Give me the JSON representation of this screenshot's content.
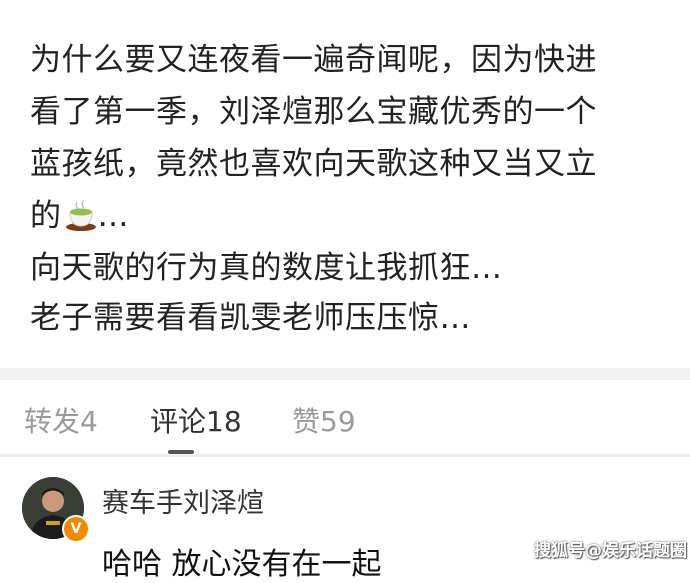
{
  "post": {
    "lines": [
      "为什么要又连夜看一遍奇闻呢，因为快进",
      "看了第一季，刘泽煊那么宝藏优秀的一个",
      "蓝孩纸，竟然也喜欢向天歌这种又当又立",
      "向天歌的行为真的数度让我抓狂…",
      "老子需要看看凯雯老师压压惊…"
    ],
    "line4_prefix": "的",
    "line4_emoji": "tea-icon",
    "line4_suffix": "…"
  },
  "tabs": {
    "repost": "转发4",
    "comments": "评论18",
    "likes": "赞59",
    "active": "comments"
  },
  "comment": {
    "author": "赛车手刘泽煊",
    "text": "哈哈 放心没有在一起",
    "badge": "V"
  },
  "watermark": "搜狐号@娱乐话题圈",
  "colors": {
    "active_tab": "#333333",
    "inactive_tab": "#9a9a9a",
    "badge": "#f08a00",
    "divider": "#f2f2f2"
  }
}
